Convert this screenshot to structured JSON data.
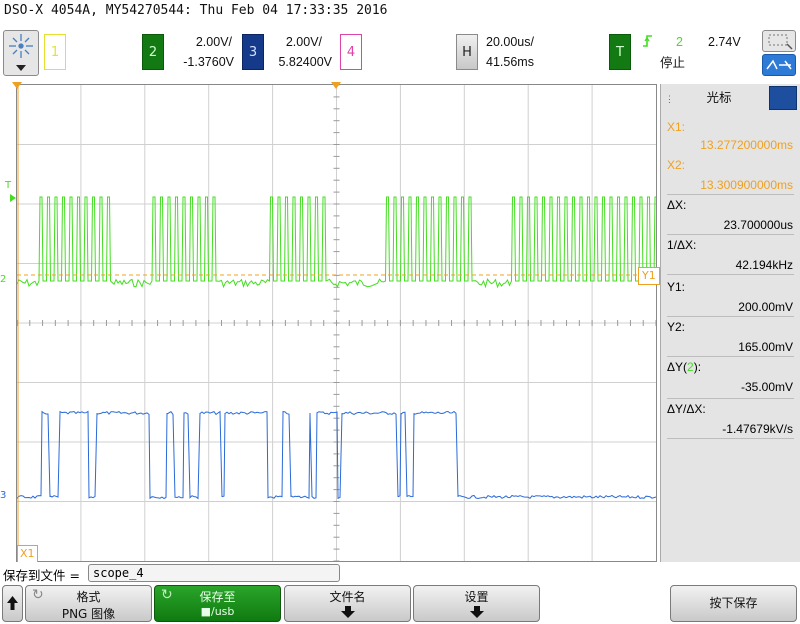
{
  "title": "DSO-X 4054A, MY54270544: Thu Feb 04 17:33:35 2016",
  "channels": {
    "ch1": {
      "number": "1"
    },
    "ch2": {
      "number": "2",
      "scale": "2.00V/",
      "offset": "-1.3760V"
    },
    "ch3": {
      "number": "3",
      "scale": "2.00V/",
      "offset": "5.82400V"
    },
    "ch4": {
      "number": "4"
    }
  },
  "horizontal": {
    "label": "H",
    "scale": "20.00us/",
    "position": "41.56ms"
  },
  "trigger": {
    "label": "T",
    "source": "2",
    "level": "2.74V",
    "status": "停止"
  },
  "markers": {
    "t_marker": "T",
    "y1_marker": "Y1",
    "x1_marker": "X1",
    "ch2_marker": "2",
    "ch3_marker": "3"
  },
  "cursors": {
    "tab_label": "光标",
    "x1_label": "X1:",
    "x1_value": "13.277200000ms",
    "x2_label": "X2:",
    "x2_value": "13.300900000ms",
    "dx_label": "ΔX:",
    "dx_value": "23.700000us",
    "inv_dx_label": "1/ΔX:",
    "inv_dx_value": "42.194kHz",
    "y1_label": "Y1:",
    "y1_value": "200.00mV",
    "y2_label": "Y2:",
    "y2_value": "165.00mV",
    "dy_label_pre": "ΔY(",
    "dy_label_ch": "2",
    "dy_label_post": "):",
    "dy_value": "-35.00mV",
    "dydx_label": "ΔY/ΔX:",
    "dydx_value": "-1.47679kV/s"
  },
  "save": {
    "label": "保存到文件 =",
    "filename": "scope_4"
  },
  "softkeys": [
    {
      "line1": "格式",
      "line2": "PNG 图像"
    },
    {
      "line1": "保存至",
      "line2": "■/usb"
    },
    {
      "line1": "文件名",
      "line2": ""
    },
    {
      "line1": "设置",
      "line2": ""
    },
    {
      "line1": "按下保存",
      "line2": ""
    }
  ],
  "colors": {
    "ch1": "#e8e030",
    "ch2": "#44dd22",
    "ch3": "#2266dd",
    "ch4": "#dd44aa",
    "cursor": "#f0a020"
  }
}
